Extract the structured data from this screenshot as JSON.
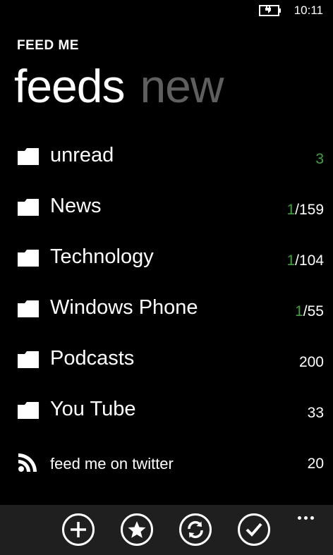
{
  "status": {
    "time": "10:11"
  },
  "app": {
    "title": "FEED ME"
  },
  "pivot": {
    "tabs": [
      "feeds",
      "new"
    ],
    "active_index": 0
  },
  "feeds": [
    {
      "label": "unread",
      "count": "3",
      "icon": "folder-icon",
      "unread": "",
      "total": ""
    },
    {
      "label": "News",
      "count": "",
      "icon": "folder-icon",
      "unread": "1",
      "total": "/159"
    },
    {
      "label": "Technology",
      "count": "",
      "icon": "folder-icon",
      "unread": "1",
      "total": "/104"
    },
    {
      "label": "Windows Phone",
      "count": "",
      "icon": "folder-icon",
      "unread": "1",
      "total": "/55"
    },
    {
      "label": "Podcasts",
      "count": "200",
      "icon": "folder-icon",
      "unread": "",
      "total": ""
    },
    {
      "label": "You Tube",
      "count": "33",
      "icon": "folder-icon",
      "unread": "",
      "total": ""
    },
    {
      "label": "feed me on twitter",
      "count": "20",
      "icon": "rss-icon",
      "unread": "",
      "total": ""
    }
  ],
  "app_bar": {
    "buttons": [
      "add-icon",
      "star-icon",
      "refresh-icon",
      "check-icon"
    ],
    "more": "more-icon"
  },
  "colors": {
    "accent": "#3aa53a",
    "background": "#000000",
    "app_bar": "#1f1f1f",
    "inactive_tab": "#5f5f5f"
  }
}
